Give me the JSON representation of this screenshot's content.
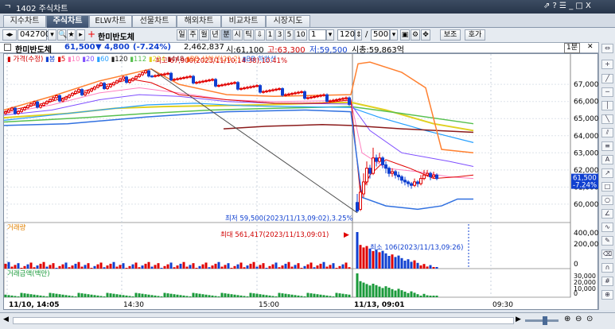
{
  "window": {
    "title": "1402 주식차트",
    "controls": "⇗ ? ☰ _ □ X"
  },
  "tabs": [
    "지수차트",
    "주식차트",
    "ELW차트",
    "선물차트",
    "해외차트",
    "비교차트",
    "시장지도"
  ],
  "toolbar": {
    "code": "042700",
    "name": "한미반도체",
    "periods": [
      "일",
      "주",
      "월",
      "년",
      "분",
      "시",
      "틱"
    ],
    "intervals": [
      "1",
      "3",
      "5",
      "10"
    ],
    "unit": "1",
    "count": "120",
    "total": "500",
    "btn_view": "보조",
    "btn_fav": "호가",
    "nav_prev": "◂▸"
  },
  "info": {
    "name": "한미반도체",
    "price": "61,500",
    "change": "▼ 4,800",
    "pct": "(-7.24%)",
    "volume": "2,462,837",
    "open": "시:61,100",
    "high": "고:63,300",
    "low": "저:59,500",
    "cap": "시총:59,863억",
    "interval": "1분"
  },
  "legend": {
    "price": "가격(수정)",
    "ma": [
      "5",
      "10",
      "20",
      "60",
      "120",
      "112",
      "224",
      "448"
    ],
    "bb": "BB 상한선(20,2)",
    "bb2": "BB 하한선"
  },
  "annotations": {
    "max": "최고 67,900(2023/11/10,14:38),10.41%",
    "min": "최저 59,500(2023/11/13,09:02),3.25%",
    "vol_max": "최대 561,417(2023/11/13,09:01)",
    "vol_min": "최소 106(2023/11/13,09:26)"
  },
  "price_axis": [
    "67,000",
    "66,000",
    "65,000",
    "64,000",
    "63,000",
    "62,000",
    "61,000",
    "60,000"
  ],
  "current_price": "61,500",
  "current_pct": "-7.24%",
  "volume_panel": {
    "title": "거래량",
    "axis": [
      "400,000",
      "200,000",
      "0"
    ]
  },
  "amount_panel": {
    "title": "거래금액(백만)",
    "axis": [
      "30,000",
      "20,000",
      "10,000",
      "0"
    ]
  },
  "time_axis": [
    "11/10, 14:05",
    "14:30",
    "15:00",
    "11/13, 09:01",
    "09:30"
  ],
  "colors": {
    "accent": "#3d5170",
    "up": "#e00000",
    "down": "#1040d0"
  }
}
